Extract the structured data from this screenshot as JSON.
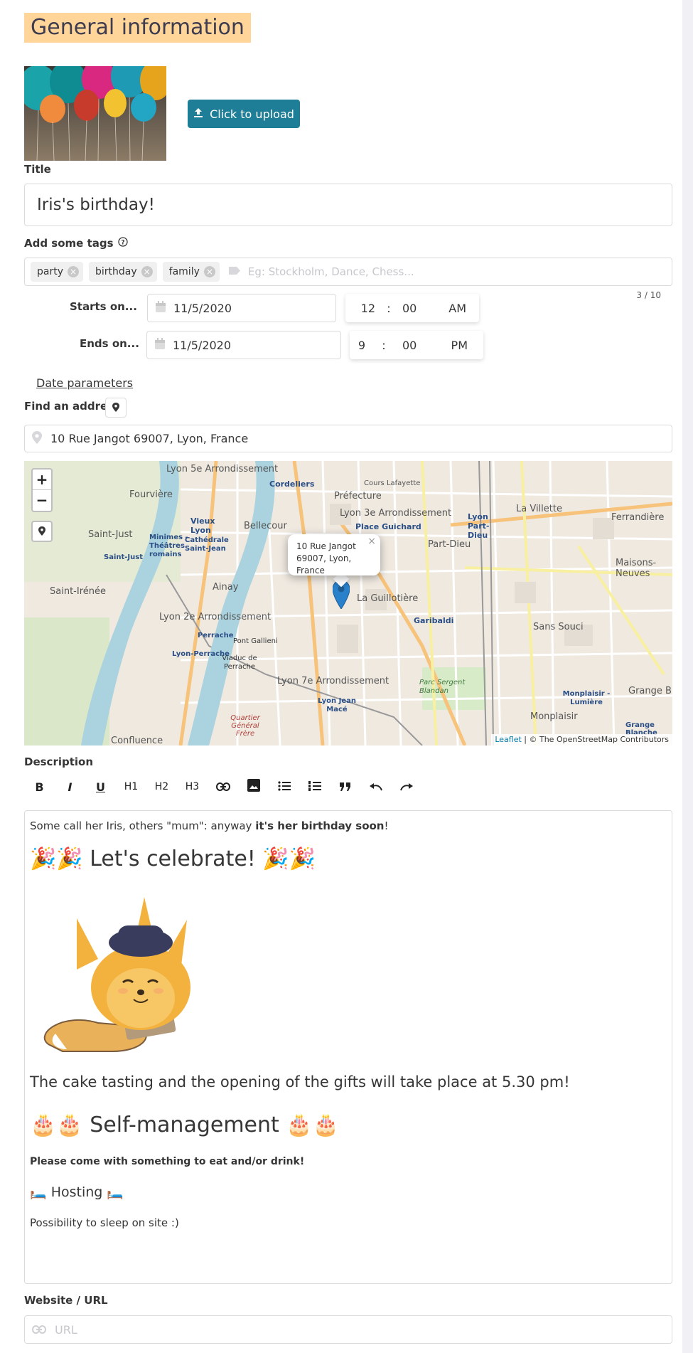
{
  "section": {
    "title": "General information"
  },
  "upload": {
    "label": "Click to upload"
  },
  "title_field": {
    "label": "Title",
    "value": "Iris's birthday!"
  },
  "tags": {
    "label": "Add some tags",
    "items": [
      {
        "label": "party"
      },
      {
        "label": "birthday"
      },
      {
        "label": "family"
      }
    ],
    "placeholder": "Eg: Stockholm, Dance, Chess...",
    "counter": "3 / 10"
  },
  "starts": {
    "label": "Starts on...",
    "date": "11/5/2020",
    "hour": "12",
    "sep": ":",
    "minute": "00",
    "ampm": "AM"
  },
  "ends": {
    "label": "Ends on...",
    "date": "11/5/2020",
    "hour": "9",
    "sep": ":",
    "minute": "00",
    "ampm": "PM"
  },
  "date_parameters": {
    "label": "Date parameters"
  },
  "address": {
    "label": "Find an address",
    "value": "10 Rue Jangot 69007, Lyon, France"
  },
  "map": {
    "zoom_in": "+",
    "zoom_out": "−",
    "popup_line1": "10 Rue Jangot",
    "popup_line2": "69007, Lyon, France",
    "popup_close": "×",
    "attribution_link": "Leaflet",
    "attribution_rest": " | © The OpenStreetMap Contributors",
    "labels": [
      "Lyon 5e Arrondissement",
      "Fourvière",
      "Cordeliers",
      "Préfecture",
      "Cours Lafayette",
      "Lyon 3e Arrondissement",
      "Place Guichard",
      "Lyon Part-Dieu",
      "La Villette",
      "Ferrandière",
      "Saint-Just",
      "Vieux Lyon",
      "Minimes - Théâtres romains",
      "Cathédrale Saint-Jean",
      "Bellecour",
      "Part-Dieu",
      "Maisons-Neuves",
      "Saint-Irénée",
      "Ainay",
      "La Guillotière",
      "Garibaldi",
      "Lyon 2e Arrondissement",
      "Perrache",
      "Pont Gallieni",
      "Sans Souci",
      "Lyon-Perrache",
      "Viaduc de Perrache",
      "Lyon 7e Arrondissement",
      "Parc Sergent Blandan",
      "Monplaisir - Lumière",
      "Grange B",
      "Quartier Général Frère",
      "Lyon Jean Macé",
      "Monplaisir",
      "Confluence",
      "Grange Blanche",
      "Saint-Just"
    ]
  },
  "description": {
    "label": "Description",
    "toolbar": {
      "bold": "B",
      "italic": "I",
      "underline": "U",
      "h1": "H1",
      "h2": "H2",
      "h3": "H3"
    },
    "p1_start": "Some call her Iris, others \"mum\": anyway ",
    "p1_bold": "it's her birthday soon",
    "p1_end": "!",
    "h_celebrate": "🎉🎉 Let's celebrate! 🎉🎉",
    "p_cake": "The cake tasting and the opening of the gifts will take place at 5.30 pm!",
    "h_self": "🎂🎂 Self-management 🎂🎂",
    "p_bring": "Please come with something to eat and/or drink!",
    "h_hosting": "🛏️ Hosting 🛏️",
    "p_sleep": "Possibility to sleep on site :)"
  },
  "website": {
    "label": "Website / URL",
    "placeholder": "URL"
  },
  "colors": {
    "accent": "#1e7d97",
    "highlight": "#ffd599",
    "map_water": "#aad3df",
    "map_road": "#f7c37b",
    "marker": "#2a81cb"
  }
}
